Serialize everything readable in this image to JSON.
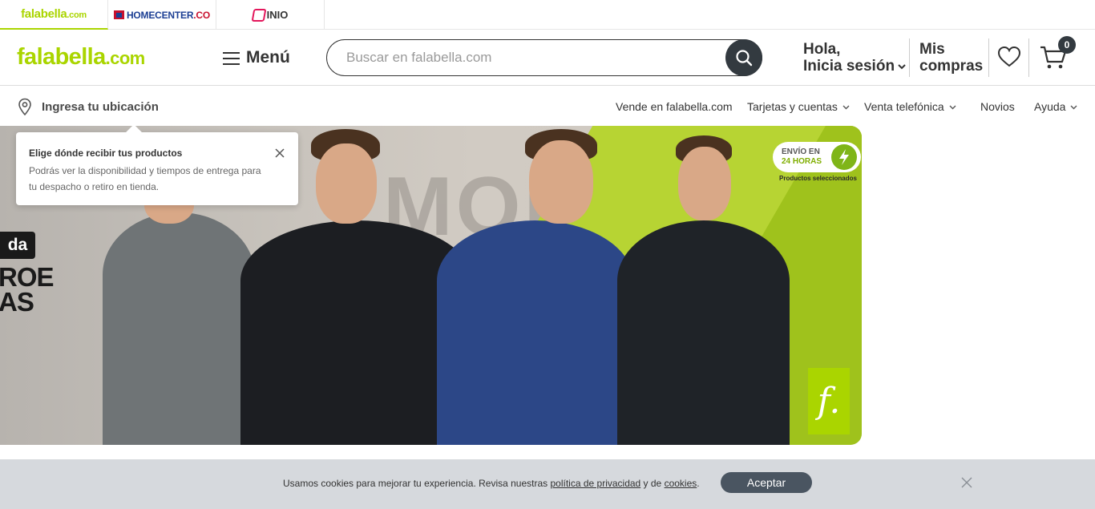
{
  "brand_tabs": {
    "falabella": "falabella",
    "falabella_suffix": ".com",
    "homecenter": "HOMECENTER",
    "homecenter_suffix": ".CO",
    "linio": "INIO"
  },
  "header": {
    "logo": "falabella",
    "logo_suffix": ".com",
    "menu_label": "Menú",
    "search_placeholder": "Buscar en falabella.com",
    "login_line1": "Hola,",
    "login_line2": "Inicia sesión",
    "orders_line1": "Mis",
    "orders_line2": "compras",
    "cart_count": "0"
  },
  "subbar": {
    "location_label": "Ingresa tu ubicación",
    "links": [
      {
        "label": "Vende en falabella.com"
      },
      {
        "label": "Tarjetas y cuentas"
      },
      {
        "label": "Venta telefónica"
      },
      {
        "label": "Novios"
      },
      {
        "label": "Ayuda"
      }
    ]
  },
  "tooltip": {
    "title": "Elige dónde recibir tus productos",
    "body": "Podrás ver la disponibilidad y tiempos de entrega para tu despacho o retiro en tienda."
  },
  "hero": {
    "bg_text": "MODA",
    "badge_text": "da",
    "headline_line1": "ROE",
    "headline_line2": "AS",
    "shipping_line1": "ENVÍO EN",
    "shipping_line2": "24 HORAS",
    "shipping_sub": "Productos seleccionados",
    "f_logo": "f."
  },
  "cookie": {
    "text_before": "Usamos cookies para mejorar tu experiencia. Revisa nuestras ",
    "privacy_link": "política de privacidad",
    "text_middle": " y de ",
    "cookies_link": "cookies",
    "text_after": ".",
    "accept_label": "Aceptar"
  },
  "colors": {
    "brand_green": "#aad500",
    "dark": "#333a40",
    "cookie_bg": "#d6d9dd"
  }
}
